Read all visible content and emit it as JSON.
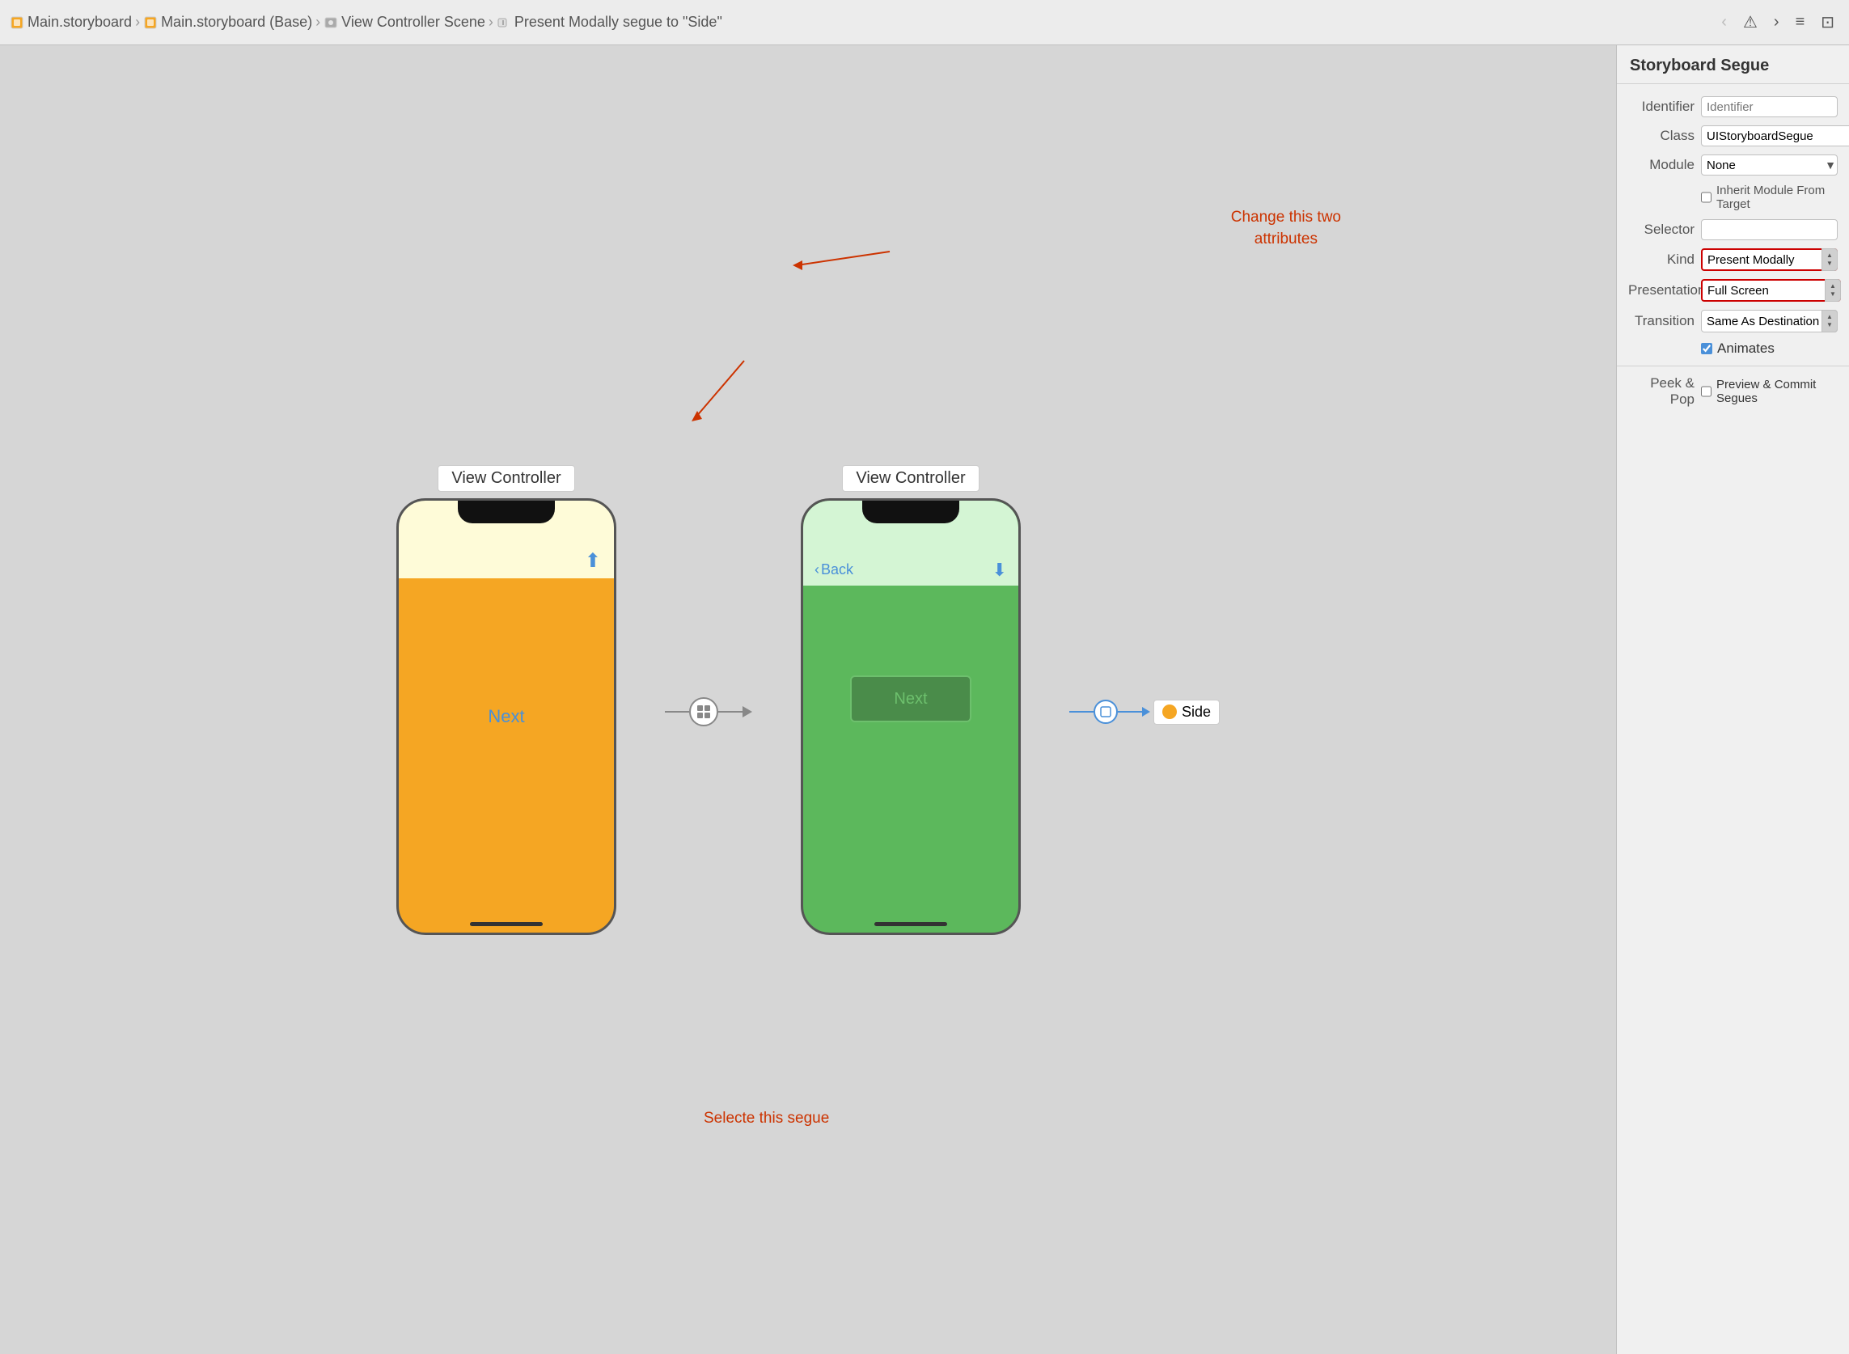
{
  "topbar": {
    "breadcrumbs": [
      {
        "label": "Main.storyboard",
        "icon": "storyboard"
      },
      {
        "label": "Main.storyboard (Base)",
        "icon": "storyboard"
      },
      {
        "label": "View Controller Scene",
        "icon": "scene"
      },
      {
        "label": "Present Modally segue to \"Side\"",
        "icon": "segue"
      }
    ],
    "nav_back_label": "‹",
    "nav_warning_label": "⚠",
    "nav_forward_label": "›",
    "menu_label": "≡",
    "window_label": "⊡"
  },
  "canvas": {
    "scene1": {
      "label": "View Controller",
      "next_text": "Next"
    },
    "scene2": {
      "label": "View Controller",
      "back_text": "Back",
      "next_text": "Next"
    },
    "annotation1": {
      "text": "Change this two\nattributes",
      "line1": "Change this two",
      "line2": "attributes"
    },
    "annotation2": {
      "text": "Selecte this segue"
    },
    "side_label": "Side"
  },
  "panel": {
    "title": "Storyboard Segue",
    "fields": {
      "identifier_label": "Identifier",
      "identifier_placeholder": "Identifier",
      "class_label": "Class",
      "class_value": "UIStoryboardSegue",
      "module_label": "Module",
      "module_value": "None",
      "inherit_label": "Inherit Module From Target",
      "selector_label": "Selector",
      "kind_label": "Kind",
      "kind_value": "Present Modally",
      "presentation_label": "Presentation",
      "presentation_value": "Full Screen",
      "transition_label": "Transition",
      "transition_value": "Same As Destination",
      "animates_label": "Animates",
      "peek_label": "Peek & Pop",
      "preview_label": "Preview & Commit Segues"
    }
  }
}
